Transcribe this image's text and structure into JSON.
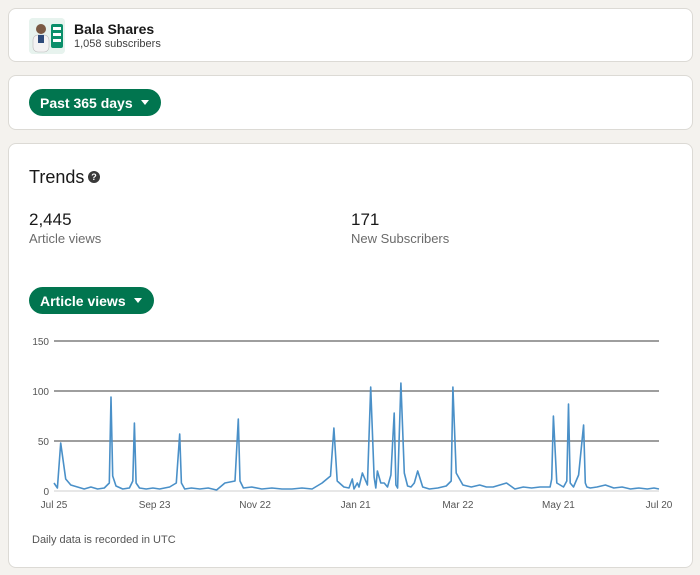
{
  "profile": {
    "name": "Bala Shares",
    "subscribers": "1,058 subscribers"
  },
  "filters": {
    "range_label": "Past 365 days",
    "metric_label": "Article views"
  },
  "trends": {
    "title": "Trends",
    "stats": [
      {
        "value": "2,445",
        "label": "Article views"
      },
      {
        "value": "171",
        "label": "New Subscribers"
      }
    ],
    "footnote": "Daily data is recorded in UTC"
  },
  "colors": {
    "accent": "#01754f",
    "line": "#4a90c8"
  },
  "chart_data": {
    "type": "line",
    "series": [
      {
        "x": [
          "Jul 25",
          "Jul 27",
          "Jul 29",
          "Aug 1",
          "Aug 4",
          "Aug 8",
          "Aug 12",
          "Aug 16",
          "Aug 20",
          "Aug 24",
          "Aug 27",
          "Aug 28",
          "Aug 29",
          "Aug 31",
          "Sep 4",
          "Sep 8",
          "Sep 10",
          "Sep 11",
          "Sep 12",
          "Sep 14",
          "Sep 18",
          "Sep 22",
          "Sep 26",
          "Oct 2",
          "Oct 6",
          "Oct 8",
          "Oct 9",
          "Oct 11",
          "Oct 15",
          "Oct 20",
          "Oct 25",
          "Oct 30",
          "Nov 4",
          "Nov 10",
          "Nov 12",
          "Nov 13",
          "Nov 15",
          "Nov 20",
          "Nov 26",
          "Dec 2",
          "Dec 8",
          "Dec 14",
          "Dec 20",
          "Dec 26",
          "Jan 1",
          "Jan 6",
          "Jan 8",
          "Jan 10",
          "Jan 14",
          "Jan 17",
          "Jan 19",
          "Jan 20",
          "Jan 22",
          "Jan 23",
          "Jan 25",
          "Jan 28",
          "Jan 30",
          "Feb 1",
          "Feb 2",
          "Feb 3",
          "Feb 5",
          "Feb 7",
          "Feb 9",
          "Feb 11",
          "Feb 13",
          "Feb 14",
          "Feb 15",
          "Feb 17",
          "Feb 19",
          "Feb 21",
          "Feb 23",
          "Feb 25",
          "Feb 27",
          "Mar 1",
          "Mar 5",
          "Mar 10",
          "Mar 15",
          "Mar 18",
          "Mar 19",
          "Mar 21",
          "Mar 25",
          "Mar 30",
          "Apr 4",
          "Apr 8",
          "Apr 12",
          "Apr 16",
          "Apr 20",
          "Apr 25",
          "Apr 30",
          "May 5",
          "May 10",
          "May 16",
          "May 17",
          "May 18",
          "May 20",
          "May 24",
          "May 26",
          "May 27",
          "May 28",
          "May 30",
          "Jun 2",
          "Jun 5",
          "Jun 6",
          "Jun 7",
          "Jun 9",
          "Jun 13",
          "Jun 18",
          "Jun 23",
          "Jun 28",
          "Jul 3",
          "Jul 8",
          "Jul 13",
          "Jul 17",
          "Jul 20"
        ],
        "y": [
          8,
          3,
          48,
          12,
          6,
          4,
          2,
          4,
          2,
          3,
          8,
          94,
          15,
          5,
          2,
          3,
          10,
          68,
          8,
          3,
          2,
          3,
          2,
          4,
          8,
          57,
          8,
          2,
          3,
          2,
          3,
          1,
          8,
          10,
          72,
          10,
          3,
          4,
          2,
          3,
          2,
          2,
          3,
          2,
          8,
          15,
          63,
          10,
          4,
          3,
          12,
          2,
          8,
          4,
          18,
          6,
          104,
          14,
          3,
          20,
          8,
          8,
          4,
          16,
          78,
          6,
          3,
          108,
          18,
          5,
          4,
          8,
          20,
          4,
          2,
          3,
          5,
          10,
          104,
          18,
          6,
          4,
          6,
          4,
          4,
          6,
          8,
          2,
          4,
          3,
          4,
          4,
          12,
          75,
          8,
          4,
          10,
          87,
          8,
          4,
          16,
          66,
          8,
          4,
          3,
          4,
          6,
          3,
          4,
          2,
          3,
          2,
          3,
          2
        ]
      }
    ],
    "x_ticks": [
      "Jul 25",
      "Sep 23",
      "Nov 22",
      "Jan 21",
      "Mar 22",
      "May 21",
      "Jul 20"
    ],
    "y_ticks": [
      0,
      50,
      100,
      150
    ],
    "ylim": [
      0,
      150
    ],
    "grid": true
  }
}
